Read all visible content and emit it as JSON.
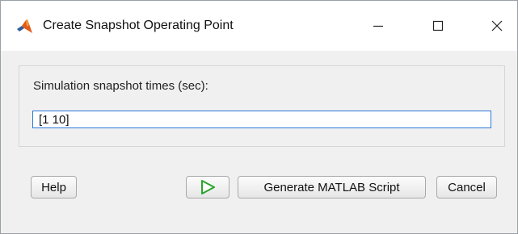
{
  "window": {
    "title": "Create Snapshot Operating Point",
    "icon": "matlab-logo-icon",
    "controls": {
      "minimize_icon": "minimize-icon",
      "maximize_icon": "maximize-icon",
      "close_icon": "close-icon"
    }
  },
  "panel": {
    "label": "Simulation snapshot times (sec):",
    "input_value": "[1 10]"
  },
  "buttons": {
    "help": "Help",
    "run_icon": "play-icon",
    "generate": "Generate MATLAB Script",
    "cancel": "Cancel"
  },
  "colors": {
    "focus_border": "#2b78d8",
    "play_green": "#2aa52a",
    "matlab_orange": "#e15a1c"
  }
}
